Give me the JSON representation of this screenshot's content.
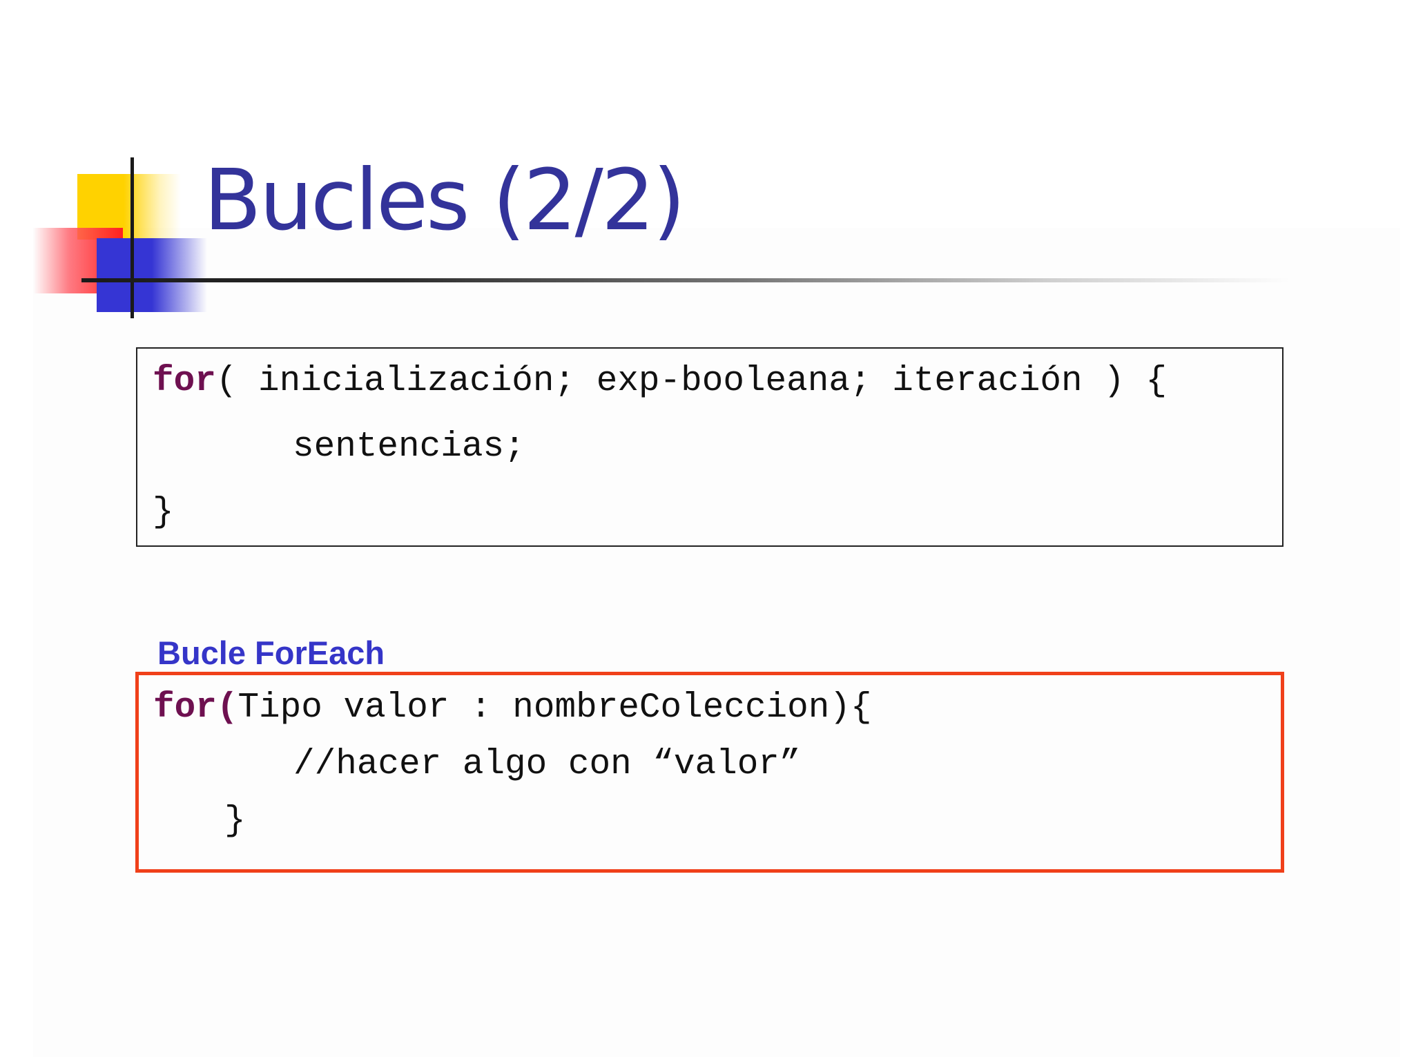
{
  "slide": {
    "title": "Bucles (2/2)"
  },
  "for_loop": {
    "keyword": "for",
    "line1_rest": "( inicialización; exp-booleana; iteración ) {",
    "line2": "sentencias;",
    "line3": "}"
  },
  "foreach": {
    "label": "Bucle ForEach",
    "keyword": "for",
    "open_paren": "(",
    "line1_rest": "Tipo valor : nombreColeccion){",
    "line2": "//hacer algo con “valor”",
    "line3": "}"
  },
  "colors": {
    "title": "#33339a",
    "keyword": "#6e1050",
    "label": "#3535c8",
    "highlight_border": "#f0401a",
    "deco_yellow": "#ffd200",
    "deco_red": "#ff2020",
    "deco_blue": "#3535d4"
  }
}
